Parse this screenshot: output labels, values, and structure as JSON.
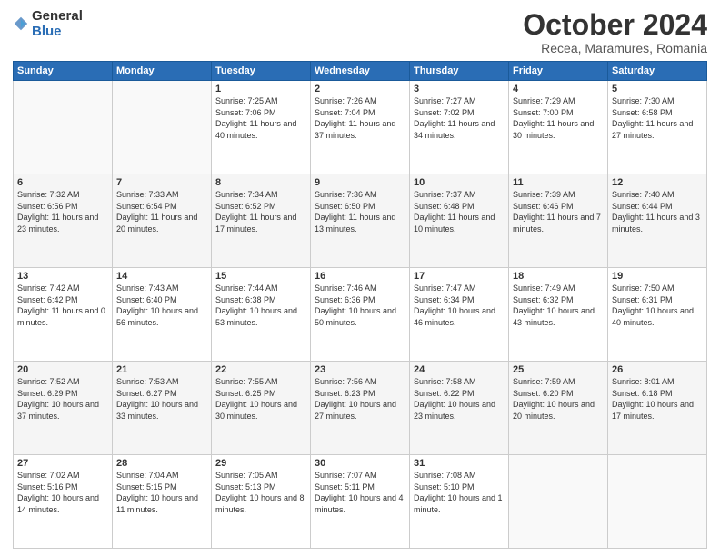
{
  "header": {
    "logo_general": "General",
    "logo_blue": "Blue",
    "title": "October 2024",
    "location": "Recea, Maramures, Romania"
  },
  "weekdays": [
    "Sunday",
    "Monday",
    "Tuesday",
    "Wednesday",
    "Thursday",
    "Friday",
    "Saturday"
  ],
  "weeks": [
    [
      {
        "day": "",
        "info": ""
      },
      {
        "day": "",
        "info": ""
      },
      {
        "day": "1",
        "info": "Sunrise: 7:25 AM\nSunset: 7:06 PM\nDaylight: 11 hours and 40 minutes."
      },
      {
        "day": "2",
        "info": "Sunrise: 7:26 AM\nSunset: 7:04 PM\nDaylight: 11 hours and 37 minutes."
      },
      {
        "day": "3",
        "info": "Sunrise: 7:27 AM\nSunset: 7:02 PM\nDaylight: 11 hours and 34 minutes."
      },
      {
        "day": "4",
        "info": "Sunrise: 7:29 AM\nSunset: 7:00 PM\nDaylight: 11 hours and 30 minutes."
      },
      {
        "day": "5",
        "info": "Sunrise: 7:30 AM\nSunset: 6:58 PM\nDaylight: 11 hours and 27 minutes."
      }
    ],
    [
      {
        "day": "6",
        "info": "Sunrise: 7:32 AM\nSunset: 6:56 PM\nDaylight: 11 hours and 23 minutes."
      },
      {
        "day": "7",
        "info": "Sunrise: 7:33 AM\nSunset: 6:54 PM\nDaylight: 11 hours and 20 minutes."
      },
      {
        "day": "8",
        "info": "Sunrise: 7:34 AM\nSunset: 6:52 PM\nDaylight: 11 hours and 17 minutes."
      },
      {
        "day": "9",
        "info": "Sunrise: 7:36 AM\nSunset: 6:50 PM\nDaylight: 11 hours and 13 minutes."
      },
      {
        "day": "10",
        "info": "Sunrise: 7:37 AM\nSunset: 6:48 PM\nDaylight: 11 hours and 10 minutes."
      },
      {
        "day": "11",
        "info": "Sunrise: 7:39 AM\nSunset: 6:46 PM\nDaylight: 11 hours and 7 minutes."
      },
      {
        "day": "12",
        "info": "Sunrise: 7:40 AM\nSunset: 6:44 PM\nDaylight: 11 hours and 3 minutes."
      }
    ],
    [
      {
        "day": "13",
        "info": "Sunrise: 7:42 AM\nSunset: 6:42 PM\nDaylight: 11 hours and 0 minutes."
      },
      {
        "day": "14",
        "info": "Sunrise: 7:43 AM\nSunset: 6:40 PM\nDaylight: 10 hours and 56 minutes."
      },
      {
        "day": "15",
        "info": "Sunrise: 7:44 AM\nSunset: 6:38 PM\nDaylight: 10 hours and 53 minutes."
      },
      {
        "day": "16",
        "info": "Sunrise: 7:46 AM\nSunset: 6:36 PM\nDaylight: 10 hours and 50 minutes."
      },
      {
        "day": "17",
        "info": "Sunrise: 7:47 AM\nSunset: 6:34 PM\nDaylight: 10 hours and 46 minutes."
      },
      {
        "day": "18",
        "info": "Sunrise: 7:49 AM\nSunset: 6:32 PM\nDaylight: 10 hours and 43 minutes."
      },
      {
        "day": "19",
        "info": "Sunrise: 7:50 AM\nSunset: 6:31 PM\nDaylight: 10 hours and 40 minutes."
      }
    ],
    [
      {
        "day": "20",
        "info": "Sunrise: 7:52 AM\nSunset: 6:29 PM\nDaylight: 10 hours and 37 minutes."
      },
      {
        "day": "21",
        "info": "Sunrise: 7:53 AM\nSunset: 6:27 PM\nDaylight: 10 hours and 33 minutes."
      },
      {
        "day": "22",
        "info": "Sunrise: 7:55 AM\nSunset: 6:25 PM\nDaylight: 10 hours and 30 minutes."
      },
      {
        "day": "23",
        "info": "Sunrise: 7:56 AM\nSunset: 6:23 PM\nDaylight: 10 hours and 27 minutes."
      },
      {
        "day": "24",
        "info": "Sunrise: 7:58 AM\nSunset: 6:22 PM\nDaylight: 10 hours and 23 minutes."
      },
      {
        "day": "25",
        "info": "Sunrise: 7:59 AM\nSunset: 6:20 PM\nDaylight: 10 hours and 20 minutes."
      },
      {
        "day": "26",
        "info": "Sunrise: 8:01 AM\nSunset: 6:18 PM\nDaylight: 10 hours and 17 minutes."
      }
    ],
    [
      {
        "day": "27",
        "info": "Sunrise: 7:02 AM\nSunset: 5:16 PM\nDaylight: 10 hours and 14 minutes."
      },
      {
        "day": "28",
        "info": "Sunrise: 7:04 AM\nSunset: 5:15 PM\nDaylight: 10 hours and 11 minutes."
      },
      {
        "day": "29",
        "info": "Sunrise: 7:05 AM\nSunset: 5:13 PM\nDaylight: 10 hours and 8 minutes."
      },
      {
        "day": "30",
        "info": "Sunrise: 7:07 AM\nSunset: 5:11 PM\nDaylight: 10 hours and 4 minutes."
      },
      {
        "day": "31",
        "info": "Sunrise: 7:08 AM\nSunset: 5:10 PM\nDaylight: 10 hours and 1 minute."
      },
      {
        "day": "",
        "info": ""
      },
      {
        "day": "",
        "info": ""
      }
    ]
  ]
}
